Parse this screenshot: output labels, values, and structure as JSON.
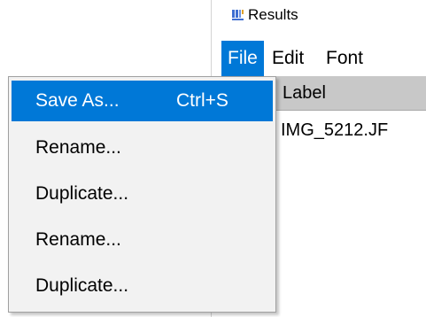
{
  "window": {
    "title": "Results",
    "icon": "imagej-results-icon"
  },
  "menubar": {
    "items": [
      {
        "label": "File",
        "active": true
      },
      {
        "label": "Edit",
        "active": false
      },
      {
        "label": "Font",
        "active": false
      }
    ]
  },
  "table": {
    "columns": [
      "Label"
    ],
    "rows": [
      {
        "label": "IMG_5212.JF"
      }
    ]
  },
  "file_menu": {
    "items": [
      {
        "label": "Save As...",
        "shortcut": "Ctrl+S",
        "highlighted": true
      },
      {
        "label": "Rename...",
        "shortcut": "",
        "highlighted": false
      },
      {
        "label": "Duplicate...",
        "shortcut": "",
        "highlighted": false
      },
      {
        "label": "Rename...",
        "shortcut": "",
        "highlighted": false
      },
      {
        "label": "Duplicate...",
        "shortcut": "",
        "highlighted": false
      }
    ]
  },
  "colors": {
    "highlight": "#0078d7",
    "menu_background": "#f2f2f2",
    "table_header": "#c8c8c8"
  }
}
